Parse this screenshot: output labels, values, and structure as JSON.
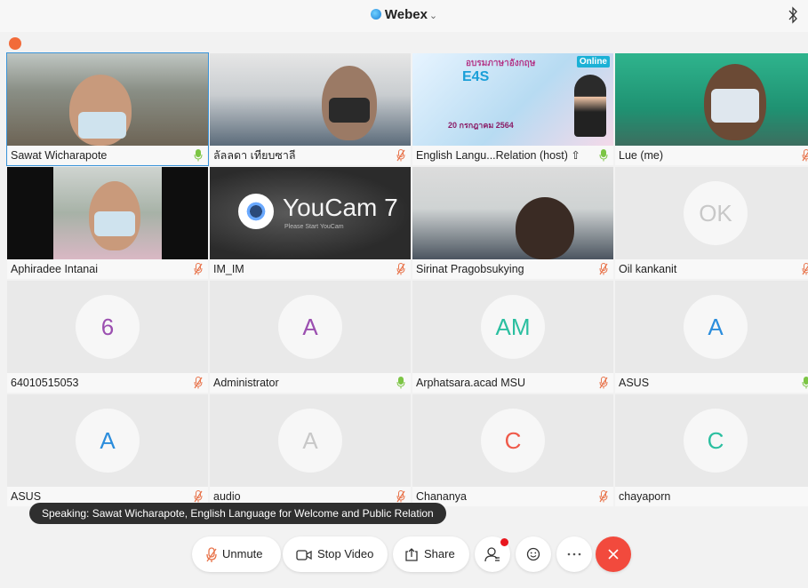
{
  "app": {
    "title": "Webex"
  },
  "participants": [
    {
      "name": "Sawat Wicharapote",
      "mic": "on",
      "tile": "video"
    },
    {
      "name": "ลัลลดา เทียบซาลี",
      "mic": "muted",
      "tile": "video"
    },
    {
      "name": "English Langu...Relation (host)",
      "mic": "on",
      "tile": "video",
      "share_glyph": "⇧"
    },
    {
      "name": "Lue (me)",
      "mic": "muted",
      "tile": "video"
    },
    {
      "name": "Aphiradee Intanai",
      "mic": "muted",
      "tile": "video"
    },
    {
      "name": "IM_IM",
      "mic": "muted",
      "tile": "video"
    },
    {
      "name": "Sirinat Pragobsukying",
      "mic": "muted",
      "tile": "video"
    },
    {
      "name": "Oil kankanit",
      "mic": "muted",
      "tile": "avatar",
      "initials": "OK",
      "color": "#c8c8c8"
    },
    {
      "name": "64010515053",
      "mic": "muted",
      "tile": "avatar",
      "initials": "6",
      "color": "#9b4fb0"
    },
    {
      "name": "Administrator",
      "mic": "on",
      "tile": "avatar",
      "initials": "A",
      "color": "#9b4fb0"
    },
    {
      "name": "Arphatsara.acad MSU",
      "mic": "muted",
      "tile": "avatar",
      "initials": "AM",
      "color": "#2bbfa0"
    },
    {
      "name": "ASUS",
      "mic": "on",
      "tile": "avatar",
      "initials": "A",
      "color": "#2b8ddc"
    },
    {
      "name": "ASUS",
      "mic": "muted",
      "tile": "avatar",
      "initials": "A",
      "color": "#2b8ddc"
    },
    {
      "name": "audio",
      "mic": "muted",
      "tile": "avatar",
      "initials": "A",
      "color": "#c8c8c8"
    },
    {
      "name": "Chananya",
      "mic": "muted",
      "tile": "avatar",
      "initials": "C",
      "color": "#ef5a4a"
    },
    {
      "name": "chayaporn",
      "mic": "none",
      "tile": "avatar",
      "initials": "C",
      "color": "#2bbfa0"
    }
  ],
  "slide": {
    "title": "อบรมภาษาอังกฤษ",
    "brand": "E4S",
    "badge": "Online",
    "date": "20 กรกฎาคม 2564"
  },
  "youcam": {
    "title": "YouCam 7",
    "subtitle": "Please Start YouCam"
  },
  "speaking_toast": "Speaking: Sawat Wicharapote, English Language for Welcome and Public Relation",
  "controls": {
    "unmute": "Unmute",
    "stop_video": "Stop Video",
    "share": "Share"
  },
  "colors": {
    "mic_on": "#7cc544",
    "mic_muted": "#e8734a",
    "selected_border": "#3b94d9",
    "leave": "#f24a3d"
  }
}
